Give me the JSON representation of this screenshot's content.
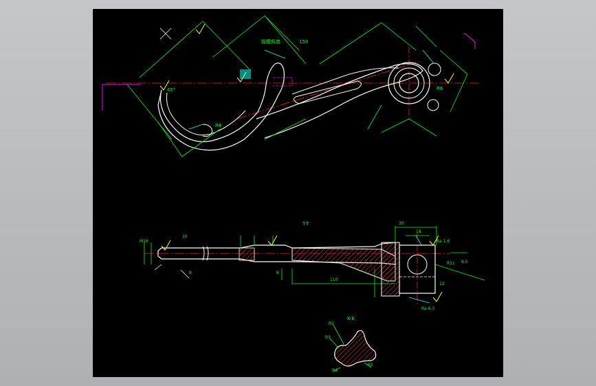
{
  "drawing": {
    "colors": {
      "outline": "#ffffff",
      "dimension": "#00ff00",
      "centerline": "#ff2020",
      "hidden": "#ff00ff",
      "leader": "#00ffff",
      "hatch": "#ffff00",
      "background": "#000000"
    },
    "top_view": {
      "annotations": [
        "锻模斜度",
        "R8",
        "45°",
        "R6",
        "150"
      ]
    },
    "side_view": {
      "annotations": [
        "T-T",
        "10",
        "8",
        "M16",
        "30",
        "18",
        "110",
        "8",
        "12",
        "R11",
        "Ra 1.6",
        "Ra 6.3",
        "8.5"
      ]
    },
    "section_view": {
      "label": "K-K",
      "annotations": [
        "R5",
        "R3",
        "R5",
        "R4"
      ]
    }
  }
}
